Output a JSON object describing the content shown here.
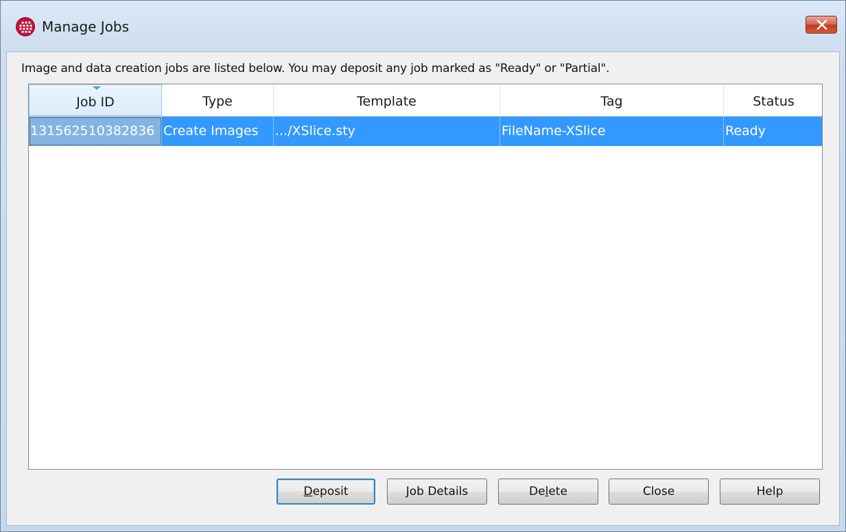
{
  "window": {
    "title": "Manage Jobs",
    "icon": "app-grid-icon",
    "close_icon": "close-icon"
  },
  "instruction": "Image and data creation jobs are listed below. You may deposit any job marked as \"Ready\" or \"Partial\".",
  "table": {
    "columns": [
      "Job ID",
      "Type",
      "Template",
      "Tag",
      "Status"
    ],
    "sorted_column": "Job ID",
    "rows": [
      {
        "job_id": "131562510382836",
        "type": "Create Images",
        "template": ".../XSlice.sty",
        "tag": "FileName-XSlice",
        "status": "Ready",
        "selected": true
      }
    ]
  },
  "buttons": {
    "deposit": {
      "pre": "",
      "mnemonic": "D",
      "post": "eposit"
    },
    "job_details": {
      "pre": "",
      "mnemonic": "J",
      "post": "ob Details"
    },
    "delete": {
      "pre": "De",
      "mnemonic": "l",
      "post": "ete"
    },
    "close": {
      "pre": "Close",
      "mnemonic": "",
      "post": ""
    },
    "help": {
      "pre": "Help",
      "mnemonic": "",
      "post": ""
    }
  },
  "colors": {
    "selection": "#3399ff",
    "app_icon": "#c2123b",
    "close_button": "#c94a30"
  }
}
